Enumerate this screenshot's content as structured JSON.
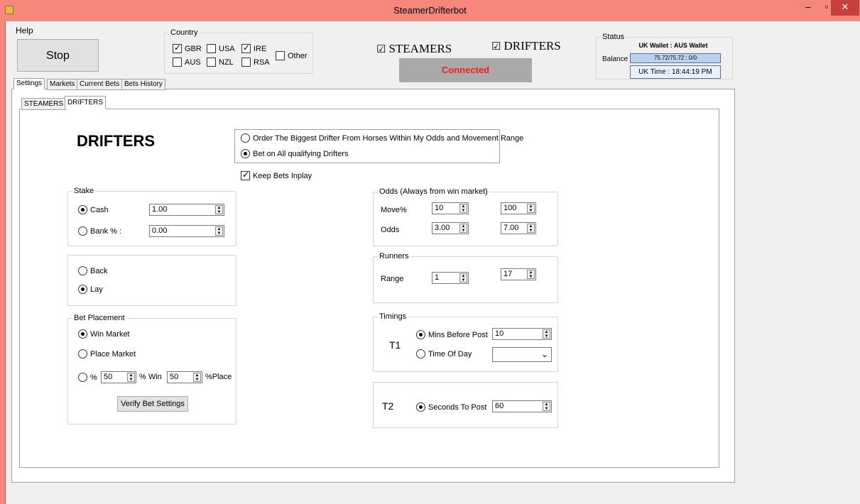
{
  "window": {
    "title": "SteamerDrifterbot",
    "minimize_glyph": "–",
    "maximize_glyph": "▫",
    "close_glyph": "✕",
    "app_icon": "app-icon"
  },
  "menu": {
    "help": "Help"
  },
  "toolbar": {
    "stop_label": "Stop"
  },
  "country": {
    "legend": "Country",
    "items": [
      {
        "label": "GBR",
        "checked": true
      },
      {
        "label": "USA",
        "checked": false
      },
      {
        "label": "IRE",
        "checked": true
      },
      {
        "label": "AUS",
        "checked": false
      },
      {
        "label": "NZL",
        "checked": false
      },
      {
        "label": "RSA",
        "checked": false
      },
      {
        "label": "Other",
        "checked": false
      }
    ]
  },
  "mode": {
    "steamers": {
      "label": "STEAMERS",
      "checked": true,
      "glyph": "☑"
    },
    "drifters": {
      "label": "DRIFTERS",
      "checked": true,
      "glyph": "☑"
    }
  },
  "connection": {
    "text": "Connected",
    "color": "#ff1a1a"
  },
  "status": {
    "legend": "Status",
    "wallet_title": "UK Wallet : AUS Wallet",
    "balance_label": "Balance",
    "balance_value": "75.72/75.72 : 0/0",
    "uk_time": "UK Time : 18:44:19 PM"
  },
  "main_tabs": [
    {
      "label": "Settings",
      "active": true
    },
    {
      "label": "Markets",
      "active": false
    },
    {
      "label": "Current Bets",
      "active": false
    },
    {
      "label": "Bets History",
      "active": false
    }
  ],
  "sub_tabs": [
    {
      "label": "STEAMERS",
      "active": false
    },
    {
      "label": "DRIFTERS",
      "active": true
    }
  ],
  "drifters": {
    "heading": "DRIFTERS",
    "order_option": "Order The Biggest Drifter From Horses Within My Odds and Movement Range",
    "bet_all_option": "Bet on All qualifying Drifters",
    "bet_all_selected": true,
    "keep_inplay_label": "Keep Bets Inplay",
    "keep_inplay_checked": true,
    "stake": {
      "legend": "Stake",
      "cash_label": "Cash",
      "cash_value": "1.00",
      "bank_label": "Bank % :",
      "bank_value": "0.00",
      "selected": "cash"
    },
    "side": {
      "back_label": "Back",
      "lay_label": "Lay",
      "selected": "lay"
    },
    "bet_placement": {
      "legend": "Bet Placement",
      "win_label": "Win Market",
      "place_label": "Place Market",
      "percent_label": "%",
      "win_pct_value": "50",
      "win_pct_label": "% Win",
      "place_pct_value": "50",
      "place_pct_label": "%Place",
      "verify_label": "Verify Bet Settings",
      "selected": "win"
    },
    "odds": {
      "legend": "Odds (Always from win market)",
      "move_label": "Move%",
      "move_min": "10",
      "move_max": "100",
      "odds_label": "Odds",
      "odds_min": "3.00",
      "odds_max": "7.00"
    },
    "runners": {
      "legend": "Runners",
      "range_label": "Range",
      "range_min": "1",
      "range_max": "17"
    },
    "timings": {
      "legend": "Timings",
      "t1_label": "T1",
      "mins_before_post_label": "Mins Before Post",
      "mins_value": "10",
      "time_of_day_label": "Time Of Day",
      "t1_selected": "mins",
      "t2_label": "T2",
      "seconds_to_post_label": "Seconds To Post",
      "seconds_value": "60"
    }
  }
}
